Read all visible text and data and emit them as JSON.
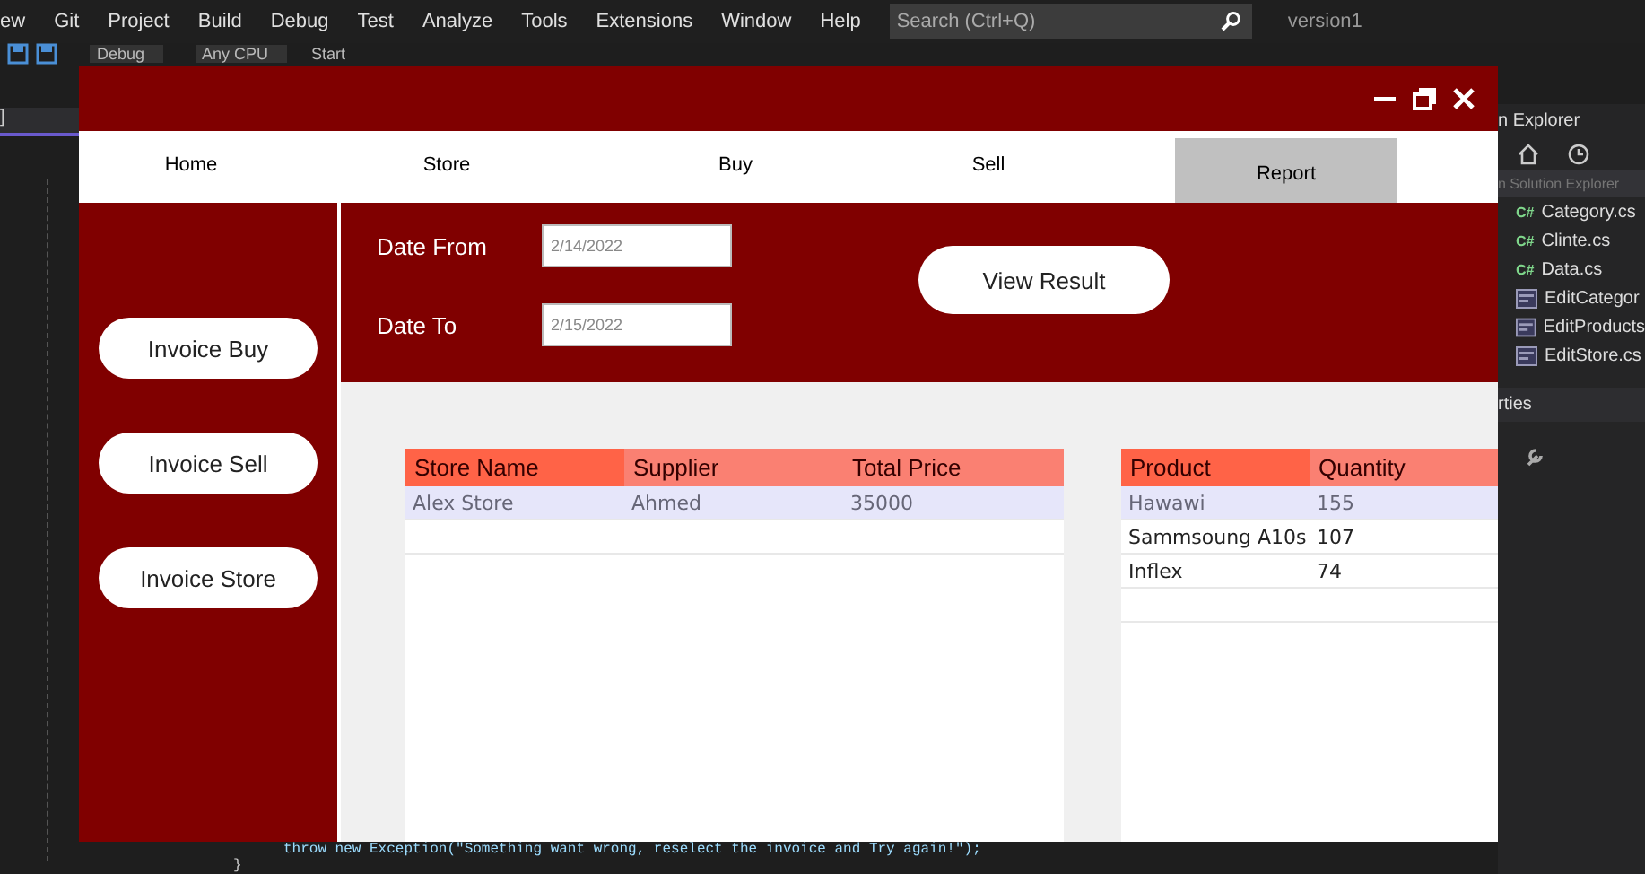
{
  "ide": {
    "menu": [
      "ew",
      "Git",
      "Project",
      "Build",
      "Debug",
      "Test",
      "Analyze",
      "Tools",
      "Extensions",
      "Window",
      "Help"
    ],
    "search": {
      "placeholder": "Search (Ctrl+Q)"
    },
    "solution_name": "version1",
    "toolbar": [
      "Debug",
      "Any CPU",
      "Start"
    ],
    "left_tab": "]",
    "solution_explorer": {
      "title": "n Explorer",
      "search": {
        "placeholder": "n Solution Explorer"
      },
      "files": [
        {
          "name": "Category.cs",
          "kind": "cs",
          "icon_label": "C#"
        },
        {
          "name": "Clinte.cs",
          "kind": "cs",
          "icon_label": "C#"
        },
        {
          "name": "Data.cs",
          "kind": "cs",
          "icon_label": "C#"
        },
        {
          "name": "EditCategor",
          "kind": "form"
        },
        {
          "name": "EditProducts",
          "kind": "form"
        },
        {
          "name": "EditStore.cs",
          "kind": "form"
        }
      ]
    },
    "properties_title": "rties",
    "code_lines": [
      "throw new Exception(\"Something want wrong, reselect the invoice and Try again!\");",
      "}"
    ]
  },
  "form": {
    "nav": [
      {
        "label": "Home",
        "selected": false
      },
      {
        "label": "Store",
        "selected": false
      },
      {
        "label": "Buy",
        "selected": false
      },
      {
        "label": "Sell",
        "selected": false
      },
      {
        "label": "Report",
        "selected": true
      }
    ],
    "sidebar": [
      "Invoice Buy",
      "Invoice Sell",
      "Invoice Store"
    ],
    "date_from": {
      "label": "Date From",
      "value": "2/14/2022"
    },
    "date_to": {
      "label": "Date To",
      "value": "2/15/2022"
    },
    "view_button": "View Result",
    "store_table": {
      "columns": [
        "Store Name",
        "Supplier",
        "Total Price"
      ],
      "rows": [
        {
          "cells": [
            "Alex Store",
            "Ahmed",
            "35000"
          ],
          "selected": true
        }
      ]
    },
    "product_table": {
      "columns": [
        "Product",
        "Quantity"
      ],
      "rows": [
        {
          "cells": [
            "Hawawi",
            "155"
          ],
          "selected": true
        },
        {
          "cells": [
            "Sammsoung A10s",
            "107"
          ],
          "selected": false
        },
        {
          "cells": [
            "Inflex",
            "74"
          ],
          "selected": false
        }
      ]
    }
  }
}
